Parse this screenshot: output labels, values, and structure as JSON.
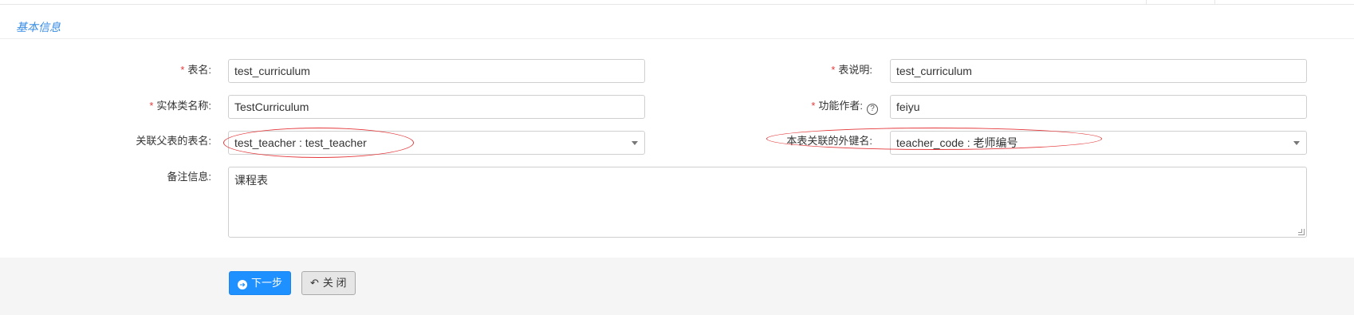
{
  "section": {
    "title": "基本信息"
  },
  "form": {
    "table_name": {
      "label": "表名:",
      "required": "*",
      "value": "test_curriculum"
    },
    "table_desc": {
      "label": "表说明:",
      "required": "*",
      "value": "test_curriculum"
    },
    "entity_name": {
      "label": "实体类名称:",
      "required": "*",
      "value": "TestCurriculum"
    },
    "author": {
      "label": "功能作者:",
      "required": "*",
      "help": "?",
      "value": "feiyu"
    },
    "parent_table": {
      "label": "关联父表的表名:",
      "value": "test_teacher : test_teacher"
    },
    "foreign_key": {
      "label": "本表关联的外键名:",
      "value": "teacher_code : 老师编号"
    },
    "remarks": {
      "label": "备注信息:",
      "value": "课程表"
    }
  },
  "footer": {
    "next_icon": "➜",
    "next_label": "下一步",
    "close_icon": "↶",
    "close_label": "关 闭"
  },
  "colors": {
    "accent": "#1e90ff",
    "required": "#e4393c",
    "annotation": "#e4393c"
  }
}
